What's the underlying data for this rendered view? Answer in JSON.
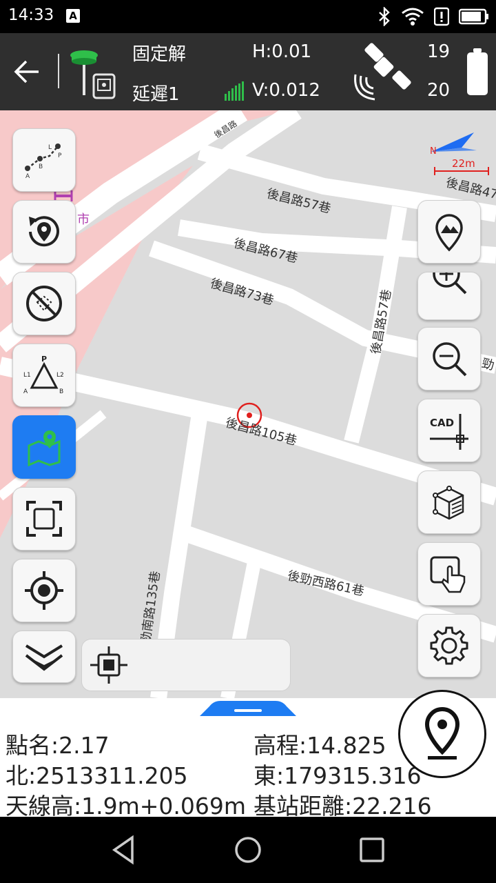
{
  "status_bar": {
    "time": "14:33",
    "notification_icon": "A",
    "icons": [
      "bluetooth-icon",
      "wifi-icon",
      "alert-icon",
      "battery-icon"
    ]
  },
  "toolbar": {
    "solution": "固定解",
    "latency": "延遲1",
    "h_precision": "H:0.01",
    "v_precision": "V:0.012",
    "satellites_used": "19",
    "satellites_tracked": "20",
    "colors": {
      "bg": "#2f2f2f",
      "signal": "#2fbf4a",
      "receiver_green": "#2fbf4a"
    }
  },
  "map": {
    "scale_label": "22m",
    "north_label": "N",
    "poi_label": "市",
    "streets": [
      {
        "id": "s1",
        "text": "後昌路"
      },
      {
        "id": "s2",
        "text": "後昌路47"
      },
      {
        "id": "s3",
        "text": "後昌路57巷"
      },
      {
        "id": "s4",
        "text": "後昌路67巷"
      },
      {
        "id": "s5",
        "text": "後昌路73巷"
      },
      {
        "id": "s6",
        "text": "後昌路57巷"
      },
      {
        "id": "s7",
        "text": "後昌路105巷"
      },
      {
        "id": "s8",
        "text": "勁南路135巷"
      },
      {
        "id": "s9",
        "text": "後勁西路61巷"
      },
      {
        "id": "s10",
        "text": "勁"
      }
    ],
    "left_tools": [
      "line-measure-tool",
      "rotate-location-tool",
      "no-layer-tool",
      "triangle-tool",
      "map-layer-tool",
      "fullscreen-tool",
      "locate-tool",
      "collapse-tool"
    ],
    "right_tools": [
      "photo-point-tool",
      "zoom-in-tool",
      "zoom-out-tool",
      "cad-tool",
      "3d-tool",
      "touch-tool",
      "settings-tool"
    ],
    "cad_label": "CAD",
    "colors": {
      "active_button": "#1e7cf2",
      "pink_area": "#f7c9c9",
      "marker": "#e0201e"
    }
  },
  "info": {
    "point_name": "點名:2.17",
    "elevation": "高程:14.825",
    "north": "北:2513311.205",
    "east": "東:179315.316",
    "antenna_height": "天線高:1.9m+0.069m",
    "base_distance": "基站距離:22.216"
  },
  "nav_bar": {
    "buttons": [
      "back-nav-icon",
      "home-nav-icon",
      "recents-nav-icon"
    ]
  }
}
